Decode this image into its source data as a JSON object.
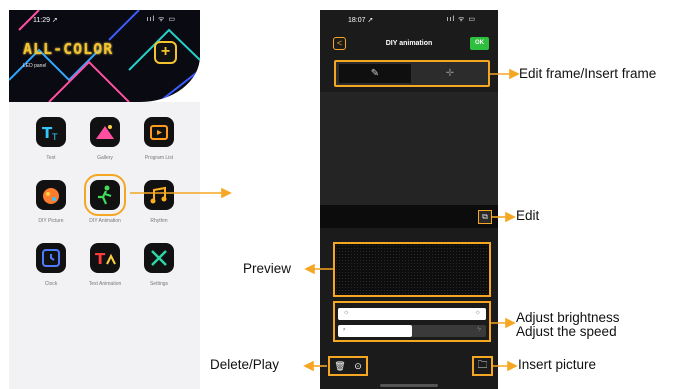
{
  "left_phone": {
    "status_time": "11:29 ➚",
    "status_icons": "ııl ᯤ ▭",
    "brand_title": "ALL-COLOR",
    "brand_subtitle": "LED panel",
    "add_icon": "plus-icon",
    "apps": [
      {
        "label": "Text",
        "icon": "text-icon"
      },
      {
        "label": "Gallery",
        "icon": "gallery-icon"
      },
      {
        "label": "Program List",
        "icon": "program-list-icon"
      },
      {
        "label": "DIY Picture",
        "icon": "diy-picture-icon"
      },
      {
        "label": "DIY Animation",
        "icon": "diy-animation-icon",
        "selected": true
      },
      {
        "label": "Rhythm",
        "icon": "rhythm-icon"
      },
      {
        "label": "Clock",
        "icon": "clock-icon"
      },
      {
        "label": "Text Animation",
        "icon": "text-animation-icon"
      },
      {
        "label": "Settings",
        "icon": "settings-icon"
      }
    ]
  },
  "right_phone": {
    "status_time": "18:07 ➚",
    "status_icons": "ııl ᯤ ▭",
    "title": "DIY animation",
    "back_label": "<",
    "ok_label": "OK",
    "brightness_level": 1.0,
    "speed_level": 0.5
  },
  "annotations": {
    "edit_insert_frame": "Edit frame/Insert frame",
    "edit": "Edit",
    "preview": "Preview",
    "adjust_brightness": "Adjust brightness",
    "adjust_speed": "Adjust the speed",
    "delete_play": "Delete/Play",
    "insert_picture": "Insert picture"
  },
  "colors": {
    "accent": "#f5a623",
    "brand": "#f4c430",
    "ok_green": "#2fbf3f"
  }
}
